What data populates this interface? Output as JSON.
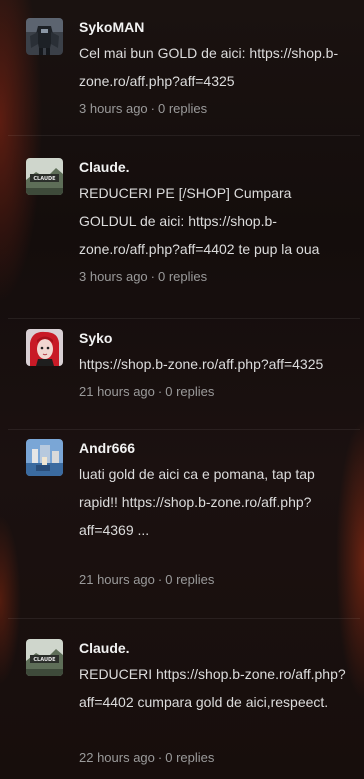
{
  "posts": [
    {
      "author": "SykoMAN",
      "avatar_icon": "robot-avatar-icon",
      "text": "Cel mai bun GOLD de aici: https://shop.b-zone.ro/aff.php?aff=4325",
      "time": "3 hours ago",
      "replies": "0 replies"
    },
    {
      "author": "Claude.",
      "avatar_icon": "claude-logo-avatar-icon",
      "text": "REDUCERI PE [/SHOP] Cumpara GOLDUL de aici: https://shop.b-zone.ro/aff.php?aff=4402 te pup la oua",
      "time": "3 hours ago",
      "replies": "0 replies"
    },
    {
      "author": "Syko",
      "avatar_icon": "red-hair-girl-avatar-icon",
      "text": "https://shop.b-zone.ro/aff.php?aff=4325",
      "time": "21 hours ago",
      "replies": "0 replies"
    },
    {
      "author": "Andr666",
      "avatar_icon": "pixel-scene-avatar-icon",
      "text": "luati gold de aici ca e pomana, tap tap rapid!! https://shop.b-zone.ro/aff.php?aff=4369 ...",
      "time": "21 hours ago",
      "replies": "0 replies"
    },
    {
      "author": "Claude.",
      "avatar_icon": "claude-logo-avatar-icon",
      "text": "REDUCERI  https://shop.b-zone.ro/aff.php?aff=4402 cumpara gold de aici,respeect.",
      "time": "22 hours ago",
      "replies": "0 replies"
    }
  ],
  "separator": "·"
}
